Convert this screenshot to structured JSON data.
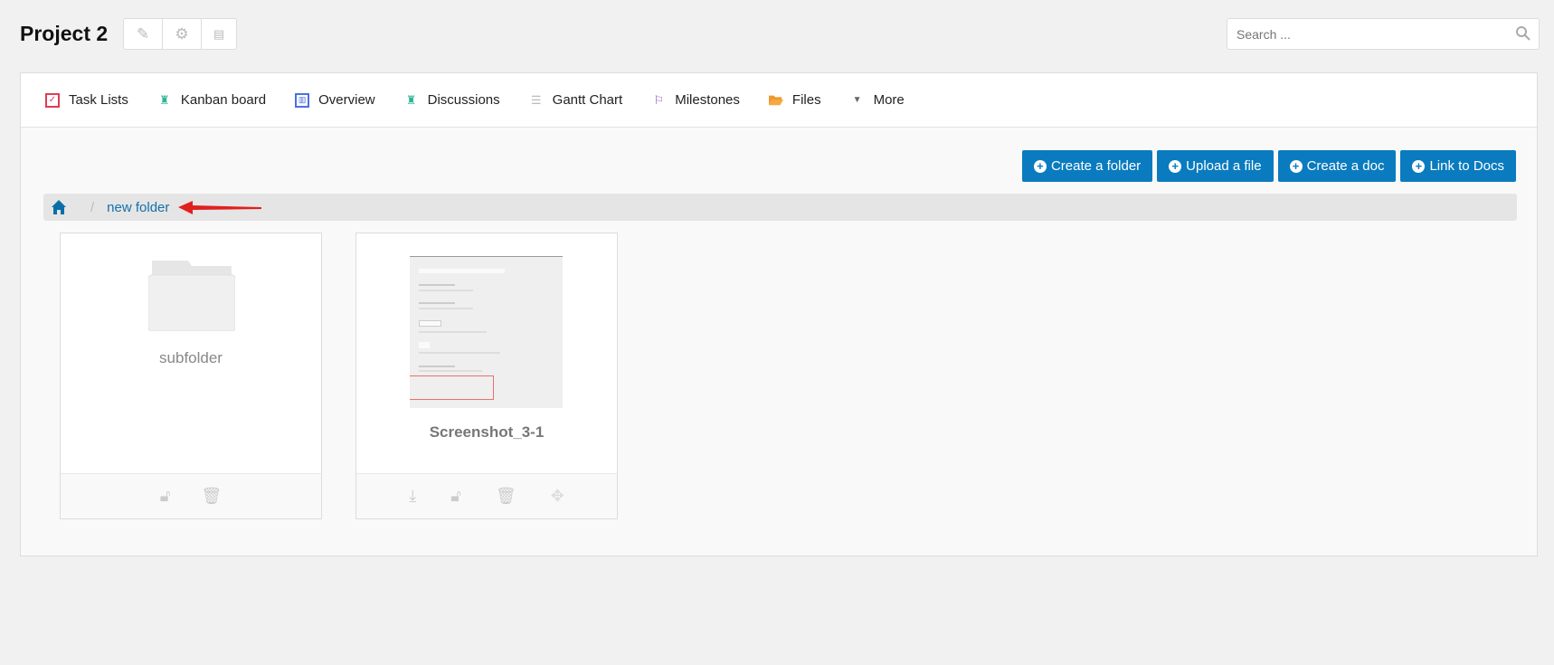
{
  "header": {
    "title": "Project 2",
    "icons": [
      "pencil-icon",
      "gear-icon",
      "document-icon"
    ]
  },
  "search": {
    "placeholder": "Search ...",
    "value": ""
  },
  "nav": {
    "tabs": [
      {
        "label": "Task Lists",
        "icon": "task-list-icon",
        "color": "#e03c52"
      },
      {
        "label": "Kanban board",
        "icon": "kanban-icon",
        "color": "#2bb59a"
      },
      {
        "label": "Overview",
        "icon": "overview-icon",
        "color": "#4c6fe0"
      },
      {
        "label": "Discussions",
        "icon": "discussion-icon",
        "color": "#2bb59a"
      },
      {
        "label": "Gantt Chart",
        "icon": "gantt-icon",
        "color": "#bbbbbb"
      },
      {
        "label": "Milestones",
        "icon": "flag-icon",
        "color": "#9b59b6"
      },
      {
        "label": "Files",
        "icon": "folder-icon",
        "color": "#f0962e"
      },
      {
        "label": "More",
        "icon": "caret-down-icon",
        "color": "#666666"
      }
    ]
  },
  "actions": {
    "create_folder": "Create a folder",
    "upload_file": "Upload a file",
    "create_doc": "Create a doc",
    "link_docs": "Link to Docs",
    "color": "#0a7bbf"
  },
  "breadcrumb": {
    "home_icon": "home-icon",
    "current": "new folder"
  },
  "items": [
    {
      "name": "subfolder",
      "type": "folder",
      "actions": [
        "unlock-icon",
        "trash-icon"
      ]
    },
    {
      "name": "Screenshot_3-1",
      "type": "image",
      "actions": [
        "download-icon",
        "unlock-icon",
        "trash-icon",
        "move-icon"
      ]
    }
  ]
}
